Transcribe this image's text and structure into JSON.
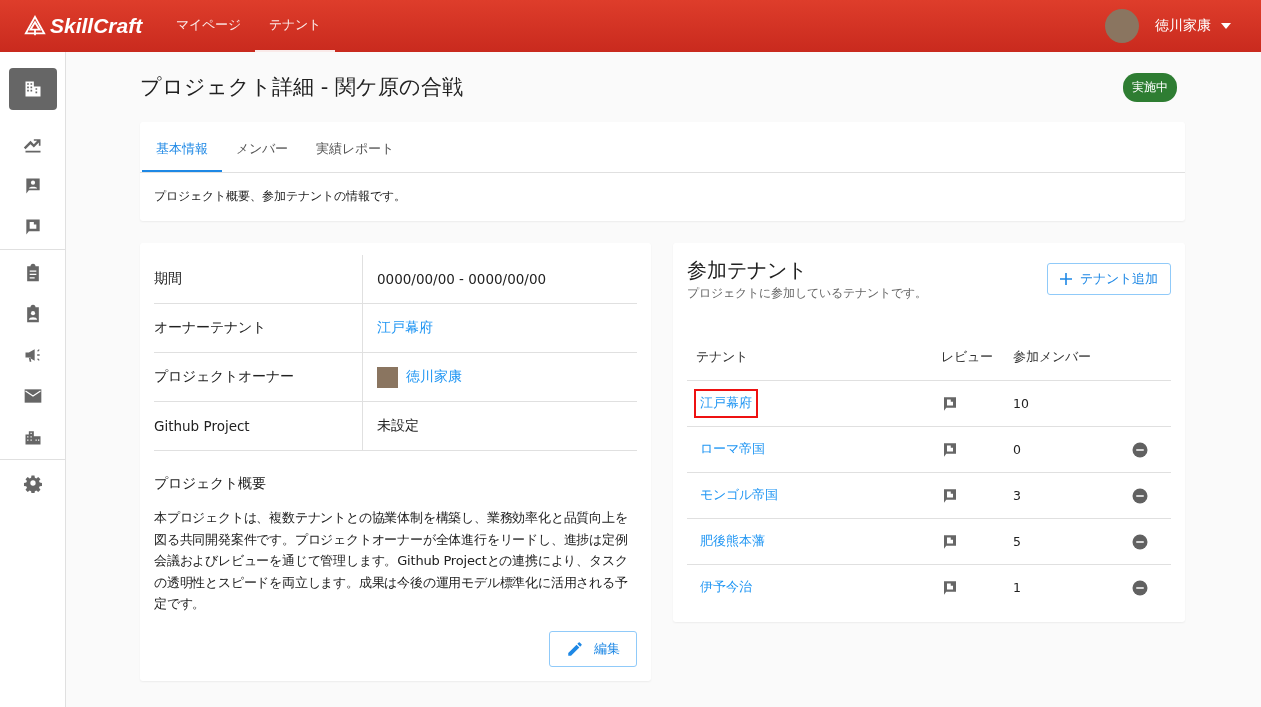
{
  "header": {
    "logo": "SkillCraft",
    "nav": [
      {
        "label": "マイページ",
        "selected": false
      },
      {
        "label": "テナント",
        "selected": true
      }
    ],
    "user": {
      "name": "徳川家康"
    }
  },
  "sidebar": {
    "groups": [
      [
        {
          "selected": true
        }
      ],
      [
        {
          "selected": false
        },
        {
          "selected": false
        },
        {
          "selected": false
        }
      ],
      [
        {
          "selected": false
        },
        {
          "selected": false
        },
        {
          "selected": false
        },
        {
          "selected": false
        },
        {
          "selected": false
        }
      ],
      [
        {
          "selected": false
        }
      ]
    ]
  },
  "page": {
    "title": "プロジェクト詳細 - 関ケ原の合戦",
    "status": "実施中"
  },
  "tabs": [
    {
      "label": "基本情報",
      "selected": true
    },
    {
      "label": "メンバー",
      "selected": false
    },
    {
      "label": "実績レポート",
      "selected": false
    }
  ],
  "tab_description": "プロジェクト概要、参加テナントの情報です。",
  "details": {
    "rows": [
      {
        "label": "期間",
        "value": "0000/00/00 - 0000/00/00",
        "kind": "text"
      },
      {
        "label": "オーナーテナント",
        "value": "江戸幕府",
        "kind": "link"
      },
      {
        "label": "プロジェクトオーナー",
        "value": "徳川家康",
        "kind": "user"
      },
      {
        "label": "Github Project",
        "value": "未設定",
        "kind": "text"
      }
    ],
    "summary_title": "プロジェクト概要",
    "summary": "本プロジェクトは、複数テナントとの協業体制を構築し、業務効率化と品質向上を図る共同開発案件です。プロジェクトオーナーが全体進行をリードし、進捗は定例会議およびレビューを通じて管理します。Github Projectとの連携により、タスクの透明性とスピードを両立します。成果は今後の運用モデル標準化に活用される予定です。",
    "edit_button": "編集"
  },
  "tenants": {
    "title": "参加テナント",
    "subtitle": "プロジェクトに参加しているテナントです。",
    "add_button": "テナント追加",
    "columns": [
      "テナント",
      "レビュー",
      "参加メンバー"
    ],
    "rows": [
      {
        "name": "江戸幕府",
        "members": "10",
        "removable": false,
        "highlighted": true
      },
      {
        "name": "ローマ帝国",
        "members": "0",
        "removable": true,
        "highlighted": false
      },
      {
        "name": "モンゴル帝国",
        "members": "3",
        "removable": true,
        "highlighted": false
      },
      {
        "name": "肥後熊本藩",
        "members": "5",
        "removable": true,
        "highlighted": false
      },
      {
        "name": "伊予今治",
        "members": "1",
        "removable": true,
        "highlighted": false
      }
    ]
  }
}
